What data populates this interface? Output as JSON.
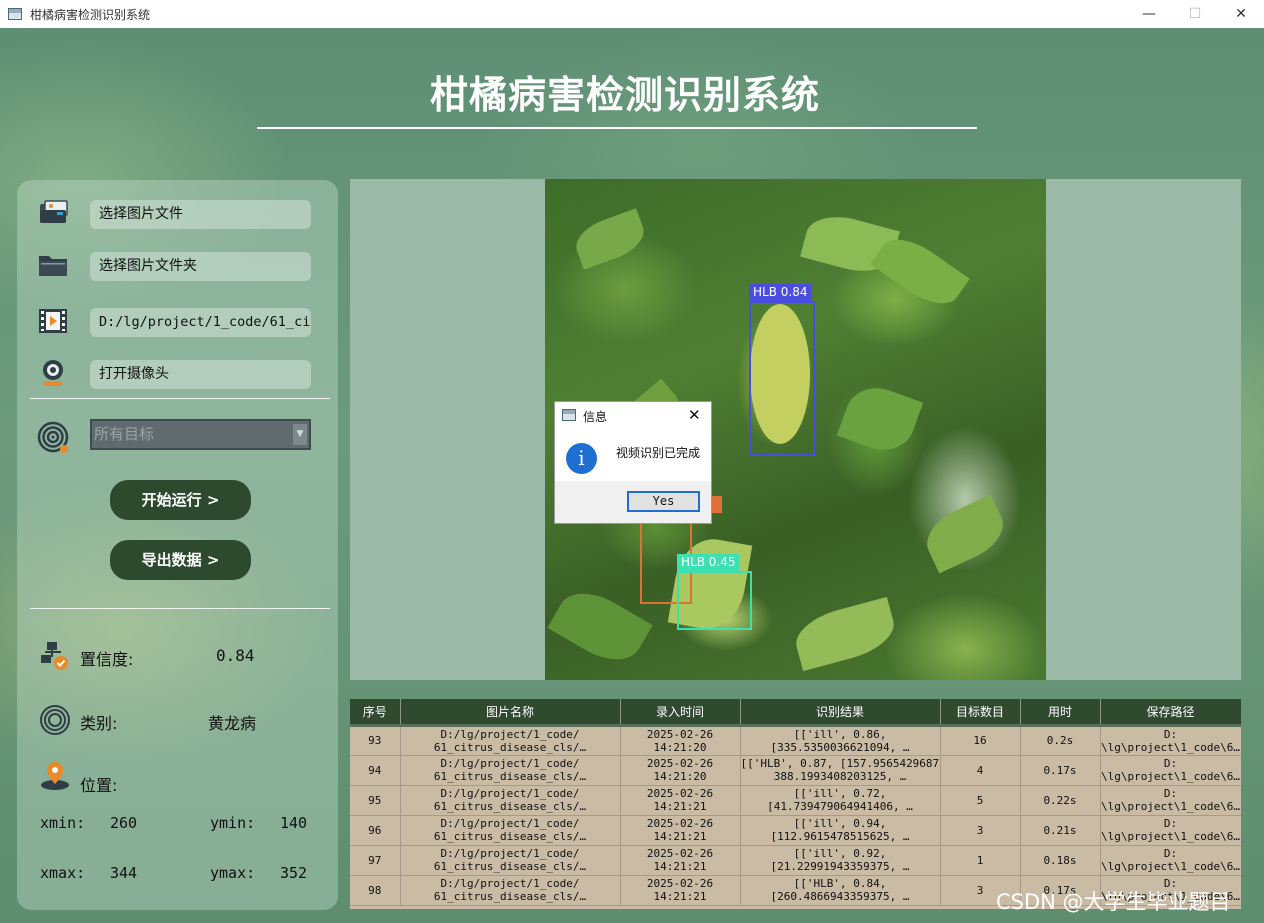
{
  "window": {
    "title": "柑橘病害检测识别系统",
    "controls": {
      "minimize": "—",
      "maximize": "☐",
      "close": "✕"
    }
  },
  "header": {
    "title": "柑橘病害检测识别系统"
  },
  "sidebar": {
    "select_image_label": "选择图片文件",
    "select_folder_label": "选择图片文件夹",
    "video_path": "D:/lg/project/1_code/61_cit",
    "open_camera_label": "打开摄像头",
    "target_select_value": "所有目标",
    "start_button": "开始运行 >",
    "export_button": "导出数据 >",
    "confidence_label": "置信度:",
    "confidence_value": "0.84",
    "category_label": "类别:",
    "category_value": "黄龙病",
    "position_label": "位置:",
    "xmin_label": "xmin:",
    "xmin_value": "260",
    "ymin_label": "ymin:",
    "ymin_value": "140",
    "xmax_label": "xmax:",
    "xmax_value": "344",
    "ymax_label": "ymax:",
    "ymax_value": "352"
  },
  "detections": [
    {
      "label": "HLB 0.84",
      "color": "#4a4de0"
    },
    {
      "label": "HLB 0.45",
      "color": "#3de0b0"
    },
    {
      "label": "",
      "color": "#e0703a"
    }
  ],
  "dialog": {
    "title": "信息",
    "message": "视频识别已完成",
    "yes_button": "Yes",
    "close": "✕",
    "info_glyph": "i"
  },
  "table": {
    "headers": [
      "序号",
      "图片名称",
      "录入时间",
      "识别结果",
      "目标数目",
      "用时",
      "保存路径"
    ],
    "rows": [
      [
        "93",
        "D:/lg/project/1_code/\n61_citrus_disease_cls/…",
        "2025-02-26\n14:21:20",
        "[['ill', 0.86,\n[335.5350036621094, …",
        "16",
        "0.2s",
        "D:\n\\lg\\project\\1_code\\6…"
      ],
      [
        "94",
        "D:/lg/project/1_code/\n61_citrus_disease_cls/…",
        "2025-02-26\n14:21:20",
        "[['HLB', 0.87, [157.95654296875,\n388.1993408203125, …",
        "4",
        "0.17s",
        "D:\n\\lg\\project\\1_code\\6…"
      ],
      [
        "95",
        "D:/lg/project/1_code/\n61_citrus_disease_cls/…",
        "2025-02-26\n14:21:21",
        "[['ill', 0.72,\n[41.739479064941406, …",
        "5",
        "0.22s",
        "D:\n\\lg\\project\\1_code\\6…"
      ],
      [
        "96",
        "D:/lg/project/1_code/\n61_citrus_disease_cls/…",
        "2025-02-26\n14:21:21",
        "[['ill', 0.94,\n[112.9615478515625, …",
        "3",
        "0.21s",
        "D:\n\\lg\\project\\1_code\\6…"
      ],
      [
        "97",
        "D:/lg/project/1_code/\n61_citrus_disease_cls/…",
        "2025-02-26\n14:21:21",
        "[['ill', 0.92,\n[21.22991943359375, …",
        "1",
        "0.18s",
        "D:\n\\lg\\project\\1_code\\6…"
      ],
      [
        "98",
        "D:/lg/project/1_code/\n61_citrus_disease_cls/…",
        "2025-02-26\n14:21:21",
        "[['HLB', 0.84,\n[260.4866943359375, …",
        "3",
        "0.17s",
        "D:\n\\lg\\project\\1_code\\6…"
      ]
    ]
  },
  "watermark": "CSDN @大学生毕业题目"
}
